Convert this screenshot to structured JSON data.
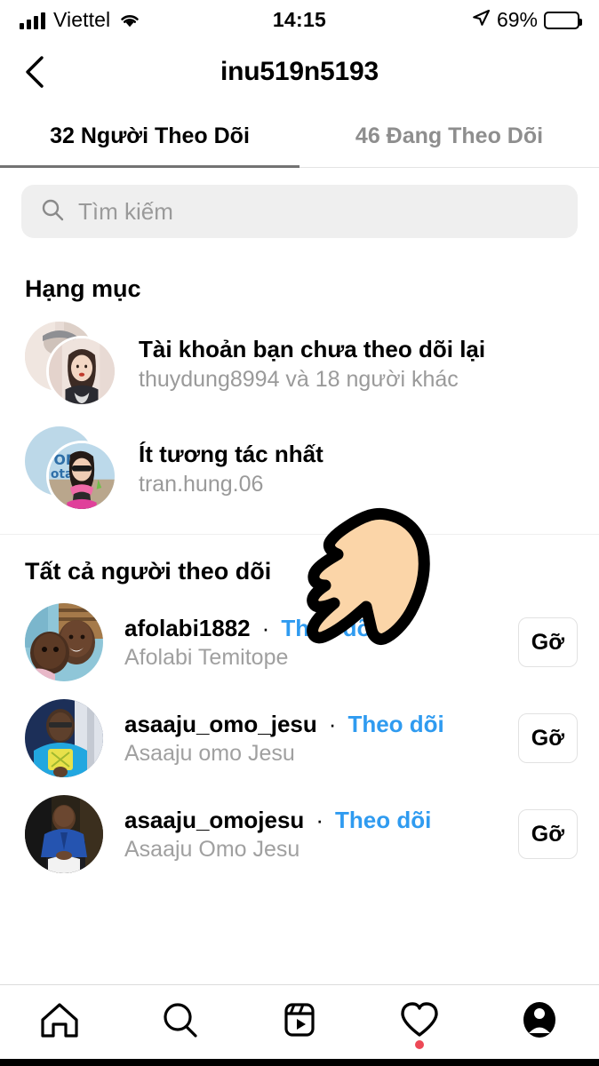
{
  "status_bar": {
    "carrier": "Viettel",
    "time": "14:15",
    "battery_percent": "69%",
    "battery_level": 69,
    "signal_icon": "cellular-signal-icon",
    "wifi_icon": "wifi-icon",
    "location_icon": "location-arrow-icon",
    "battery_icon": "battery-icon"
  },
  "nav": {
    "back_icon": "back-chevron-icon",
    "title": "inu519n5193"
  },
  "tabs": [
    {
      "label": "32 Người Theo Dõi",
      "active": true
    },
    {
      "label": "46 Đang Theo Dõi",
      "active": false
    }
  ],
  "search": {
    "placeholder": "Tìm kiếm",
    "value": "",
    "icon": "search-icon"
  },
  "categories": {
    "heading": "Hạng mục",
    "items": [
      {
        "title": "Tài khoản bạn chưa theo dõi lại",
        "subtitle": "thuydung8994 và 18 người khác",
        "avatar": "stacked-avatars"
      },
      {
        "title": "Ít tương tác nhất",
        "subtitle": "tran.hung.06",
        "avatar": "stacked-avatars"
      }
    ]
  },
  "all_followers": {
    "heading": "Tất cả người theo dõi",
    "follow_label": "Theo dõi",
    "remove_label": "Gỡ",
    "separator": "·",
    "items": [
      {
        "username": "afolabi1882",
        "fullname": "Afolabi Temitope"
      },
      {
        "username": "asaaju_omo_jesu",
        "fullname": "Asaaju omo Jesu"
      },
      {
        "username": "asaaju_omojesu",
        "fullname": "Asaaju Omo Jesu"
      }
    ]
  },
  "bottom_nav": [
    {
      "icon": "home-icon",
      "badge": false
    },
    {
      "icon": "search-icon",
      "badge": false
    },
    {
      "icon": "reels-icon",
      "badge": false
    },
    {
      "icon": "heart-activity-icon",
      "badge": true
    },
    {
      "icon": "profile-avatar-icon",
      "badge": false
    }
  ],
  "overlay": {
    "cursor": "pointing-hand-cursor",
    "skin_color": "#FBD5A8"
  },
  "colors": {
    "link_blue": "#2F9BF0",
    "muted_text": "#9A9A9A",
    "search_bg": "#EFEFEF",
    "badge_red": "#ED4956",
    "tab_indicator": "#737373"
  }
}
